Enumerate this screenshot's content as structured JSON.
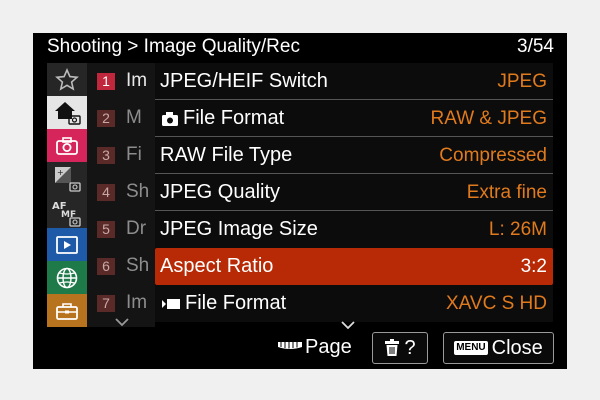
{
  "header": {
    "breadcrumb": "Shooting > Image Quality/Rec",
    "page_indicator": "3/54"
  },
  "sidebar": {
    "icons": [
      "star-icon",
      "home-camera-icon",
      "camera-icon",
      "exposure-camera-icon",
      "af-mf-icon",
      "playback-icon",
      "network-globe-icon",
      "toolbox-icon"
    ],
    "active_index": 2,
    "colors": {
      "background": "#262626",
      "active": "#d6255a",
      "highlight": "#e6e6e6"
    }
  },
  "subtabs": [
    {
      "number": "1",
      "text": "Im",
      "active": true
    },
    {
      "number": "2",
      "text": "M",
      "active": false
    },
    {
      "number": "3",
      "text": "Fi",
      "active": false
    },
    {
      "number": "4",
      "text": "Sh",
      "active": false
    },
    {
      "number": "5",
      "text": "Dr",
      "active": false
    },
    {
      "number": "6",
      "text": "Sh",
      "active": false
    },
    {
      "number": "7",
      "text": "Im",
      "active": false
    }
  ],
  "menu_items": [
    {
      "label": "JPEG/HEIF Switch",
      "value": "JPEG",
      "icon": ""
    },
    {
      "label": "File Format",
      "value": "RAW & JPEG",
      "icon": "still-camera-icon"
    },
    {
      "label": "RAW File Type",
      "value": "Compressed",
      "icon": ""
    },
    {
      "label": "JPEG Quality",
      "value": "Extra fine",
      "icon": ""
    },
    {
      "label": "JPEG Image Size",
      "value": "L: 26M",
      "icon": ""
    },
    {
      "label": "Aspect Ratio",
      "value": "3:2",
      "icon": "",
      "selected": true
    },
    {
      "label": "File Format",
      "value": "XAVC S HD",
      "icon": "movie-icon"
    }
  ],
  "bottom_bar": {
    "page_label": "Page",
    "help_label": "?",
    "menu_tag": "MENU",
    "close_label": "Close"
  },
  "colors": {
    "selected_row": "#b72a05",
    "value_text": "#e07a1d",
    "active_tab_number": "#c0263c"
  }
}
